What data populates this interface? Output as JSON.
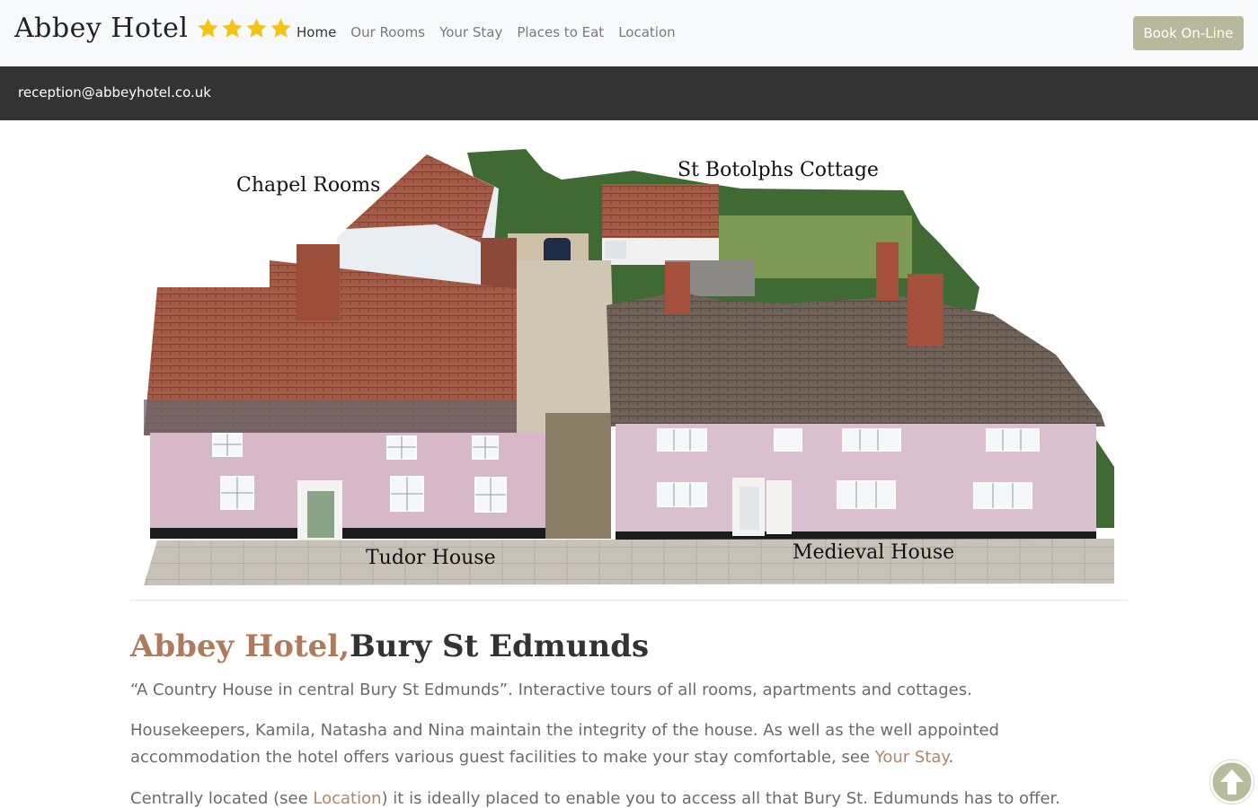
{
  "brand": {
    "name": "Abbey Hotel",
    "rating_stars": 4,
    "star_color": "#f3c318"
  },
  "nav": {
    "items": [
      {
        "label": "Home",
        "active": true
      },
      {
        "label": "Our Rooms"
      },
      {
        "label": "Your Stay"
      },
      {
        "label": "Places to Eat"
      },
      {
        "label": "Location"
      }
    ],
    "book_label": "Book On-Line"
  },
  "infobar": {
    "email": "reception@abbeyhotel.co.uk"
  },
  "hero": {
    "labels": {
      "chapel": "Chapel Rooms",
      "cottage": "St Botolphs Cottage",
      "tudor": "Tudor House",
      "medieval": "Medieval House"
    }
  },
  "content": {
    "heading_accent": "Abbey Hotel,",
    "heading_rest": "Bury St Edmunds",
    "p1": "“A Country House in central Bury St Edmunds”. Interactive tours of all rooms, apartments and cottages.",
    "p2_before": "Housekeepers, Kamila, Natasha and Nina maintain the integrity of the house. As well as the well appointed accommodation the hotel offers various guest facilities to make your stay comfortable, see ",
    "p2_link": "Your Stay",
    "p2_after": ".",
    "p3_before": "Centrally located (see ",
    "p3_link": "Location",
    "p3_after": ") it is ideally placed to enable you to access all that Bury St. Edumunds has to offer."
  },
  "colors": {
    "accent": "#b07a5e",
    "button": "#b8b89a",
    "dark_bar": "#333333"
  },
  "icons": {
    "scroll_top": "arrow-up-circle-icon"
  }
}
